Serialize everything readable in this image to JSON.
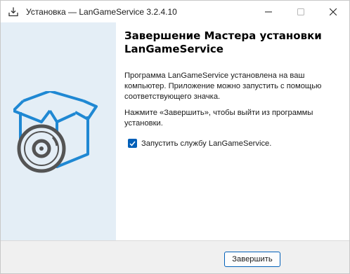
{
  "window": {
    "title": "Установка — LanGameService 3.2.4.10",
    "app_icon": "download-tray-icon",
    "controls": [
      "minimize-icon",
      "maximize-icon",
      "close-icon"
    ]
  },
  "side_panel": {
    "illustration": "software-box-with-disc-icon",
    "accent_color": "#1f88d3",
    "background_color": "#e4eef6"
  },
  "content": {
    "heading": "Завершение Мастера установки LanGameService",
    "paragraph1": "Программа LanGameService установлена на ваш компьютер. Приложение можно запустить с помощью соответствующего значка.",
    "paragraph2": "Нажмите «Завершить», чтобы выйти из программы установки.",
    "launch_checkbox": {
      "label": "Запустить службу LanGameService.",
      "checked": true
    }
  },
  "footer": {
    "finish_label": "Завершить"
  }
}
